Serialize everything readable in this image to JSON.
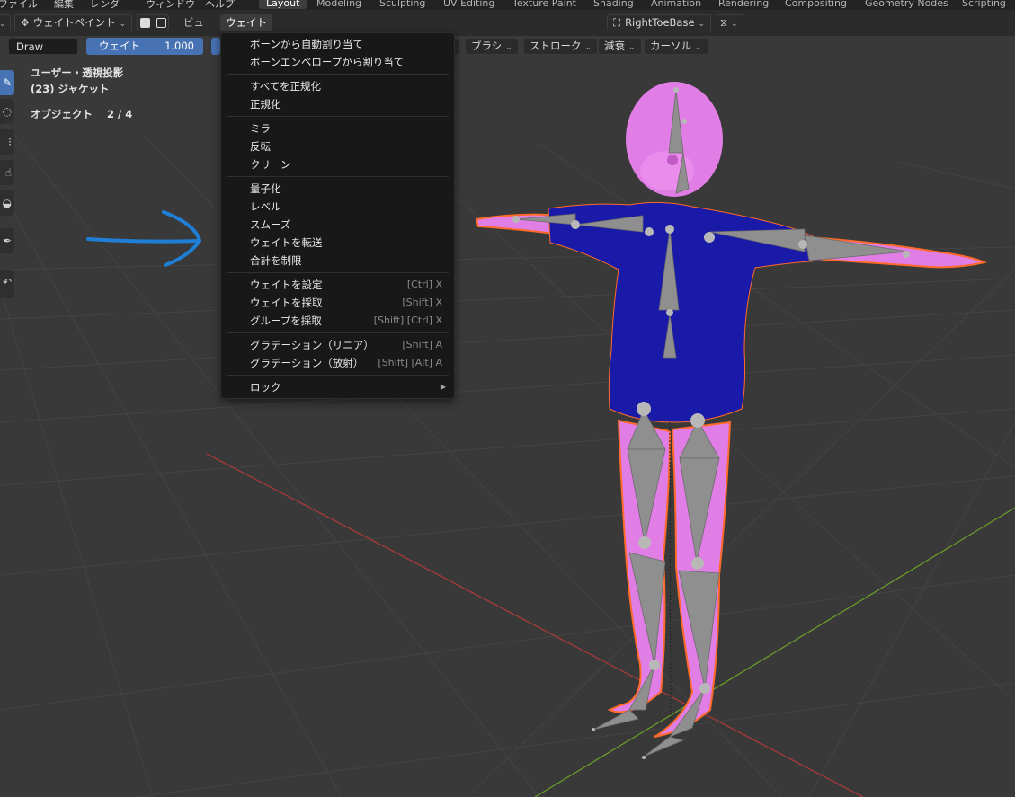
{
  "menubar": {
    "items": [
      "ファイル",
      "編集",
      "レンダ",
      "ウィンドウ",
      "ヘルプ"
    ],
    "workspaces": [
      "Layout",
      "Modeling",
      "Sculpting",
      "UV Editing",
      "Texture Paint",
      "Shading",
      "Animation",
      "Rendering",
      "Compositing",
      "Geometry Nodes",
      "Scripting"
    ],
    "active_workspace": "Layout"
  },
  "header": {
    "mode": "ウェイトペイント",
    "view": "ビュー",
    "weight_menu": "ウェイト",
    "bone": "RightToeBase"
  },
  "tool_settings": {
    "brush_name": "Draw",
    "weight_label": "ウェイト",
    "weight_value": "1.000",
    "brush": "ブラシ",
    "stroke": "ストローク",
    "falloff": "減衰",
    "cursor": "カーソル"
  },
  "viewport": {
    "view_name": "ユーザー・透視投影",
    "object": "(23) ジャケット",
    "objects_label": "オブジェクト",
    "objects_count": "2 / 4"
  },
  "weight_menu": {
    "items": [
      {
        "label": "ボーンから自動割り当て",
        "shortcut": ""
      },
      {
        "label": "ボーンエンベロープから割り当て",
        "shortcut": ""
      },
      {
        "label": "すべてを正規化",
        "shortcut": ""
      },
      {
        "label": "正規化",
        "shortcut": ""
      },
      {
        "label": "ミラー",
        "shortcut": ""
      },
      {
        "label": "反転",
        "shortcut": ""
      },
      {
        "label": "クリーン",
        "shortcut": ""
      },
      {
        "label": "量子化",
        "shortcut": ""
      },
      {
        "label": "レベル",
        "shortcut": ""
      },
      {
        "label": "スムーズ",
        "shortcut": ""
      },
      {
        "label": "ウェイトを転送",
        "shortcut": ""
      },
      {
        "label": "合計を制限",
        "shortcut": ""
      },
      {
        "label": "ウェイトを設定",
        "shortcut": "[Ctrl] X"
      },
      {
        "label": "ウェイトを採取",
        "shortcut": "[Shift] X"
      },
      {
        "label": "グループを採取",
        "shortcut": "[Shift] [Ctrl] X"
      },
      {
        "label": "グラデーション（リニア）",
        "shortcut": "[Shift] A"
      },
      {
        "label": "グラデーション（放射）",
        "shortcut": "[Shift] [Alt] A"
      },
      {
        "label": "ロック",
        "shortcut": ""
      }
    ]
  },
  "colors": {
    "accent": "#4772b3",
    "viewport_bg": "#393939",
    "jacket": "#1a1aa8",
    "body_weight": "#e07ee6",
    "bone": "#8f8f8f",
    "annotation": "#1f7fd6",
    "axis_x": "#a83a3a",
    "axis_y": "#6a9a2a"
  }
}
